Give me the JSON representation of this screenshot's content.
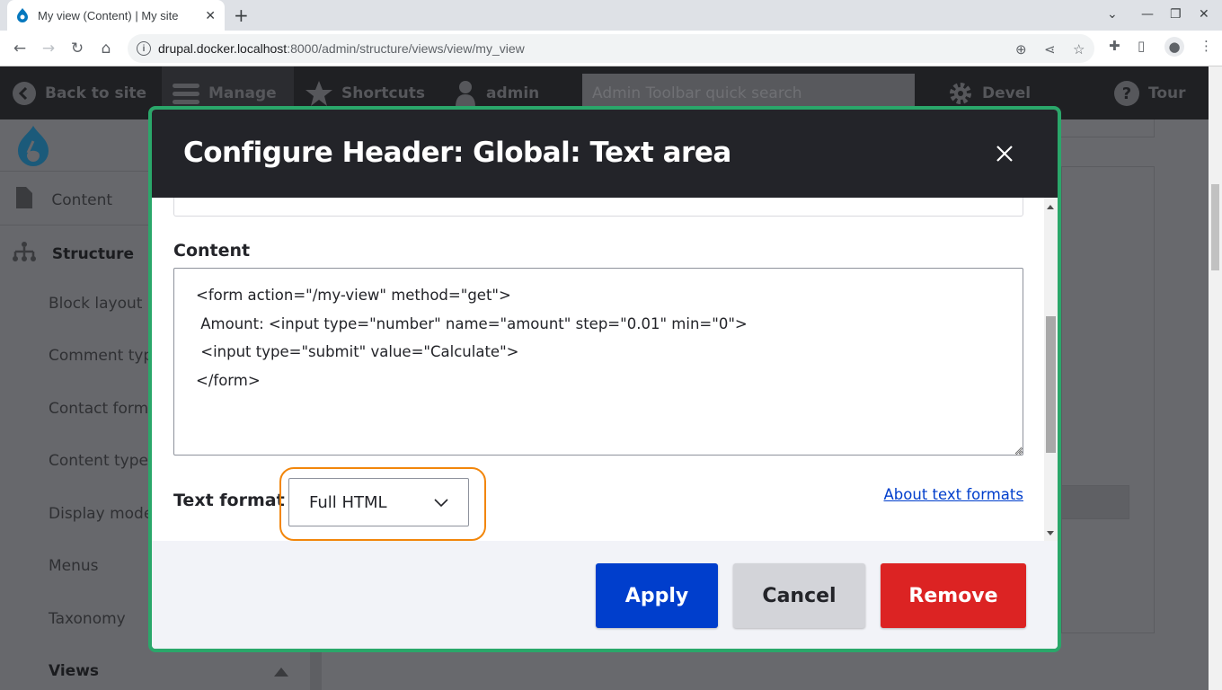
{
  "browser": {
    "tab_title": "My view (Content) | My site",
    "url_host": "drupal.docker.localhost",
    "url_path": ":8000/admin/structure/views/view/my_view"
  },
  "admin_toolbar": {
    "back_to_site": "Back to site",
    "manage": "Manage",
    "shortcuts": "Shortcuts",
    "user": "admin",
    "search_placeholder": "Admin Toolbar quick search",
    "devel": "Devel",
    "tour": "Tour"
  },
  "sidebar": {
    "items": [
      {
        "label": "Content",
        "icon": "file-icon"
      },
      {
        "label": "Structure",
        "icon": "sitemap-icon"
      },
      {
        "label": "Block layout"
      },
      {
        "label": "Comment types"
      },
      {
        "label": "Contact forms"
      },
      {
        "label": "Content types"
      },
      {
        "label": "Display modes"
      },
      {
        "label": "Menus"
      },
      {
        "label": "Taxonomy"
      },
      {
        "label": "Views"
      }
    ]
  },
  "dialog": {
    "title": "Configure Header: Global: Text area",
    "content_label": "Content",
    "content_value": "<form action=\"/my-view\" method=\"get\">\n Amount: <input type=\"number\" name=\"amount\" step=\"0.01\" min=\"0\">\n <input type=\"submit\" value=\"Calculate\">\n</form>",
    "text_format_label": "Text format",
    "text_format_value": "Full HTML",
    "about_link": "About text formats",
    "buttons": {
      "apply": "Apply",
      "cancel": "Cancel",
      "remove": "Remove"
    }
  },
  "colors": {
    "dialog_border": "#2aa76a",
    "focus_ring": "#f2860b",
    "apply": "#003ecc",
    "remove": "#dc2323",
    "cancel": "#d3d4d9"
  }
}
